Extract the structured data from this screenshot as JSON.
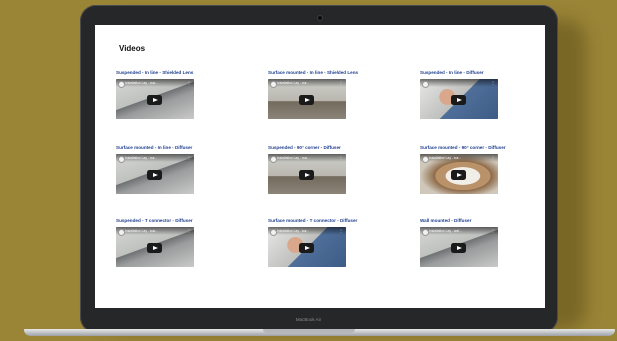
{
  "page": {
    "heading": "Videos"
  },
  "videos": [
    {
      "title": "Suspended - In line - Shielded Lens",
      "thumb_title": "Installation Lay - sus...",
      "scene": "ceiling"
    },
    {
      "title": "Surface mounted - In line - Shielded Lens",
      "thumb_title": "Installation Lay - sur...",
      "scene": "room"
    },
    {
      "title": "Suspended - In line - Diffuser",
      "thumb_title": "",
      "scene": "person"
    },
    {
      "title": "Surface mounted - In line - Diffuser",
      "thumb_title": "Installation Lay - sur...",
      "scene": "ceiling"
    },
    {
      "title": "Suspended - 90° corner - Diffuser",
      "thumb_title": "Installation Lay - sus...",
      "scene": "room"
    },
    {
      "title": "Surface mounted - 90° corner - Diffuser",
      "thumb_title": "Installation Lay - sur...",
      "scene": "wood"
    },
    {
      "title": "Suspended - T connector - Diffuser",
      "thumb_title": "Installation Lay - sus...",
      "scene": "ceiling"
    },
    {
      "title": "Surface mounted - T connector - Diffuser",
      "thumb_title": "Installation Lay - sur...",
      "scene": "person"
    },
    {
      "title": "Wall mounted - Diffuser",
      "thumb_title": "Installation Lay - wal...",
      "scene": "ceiling"
    }
  ],
  "device": {
    "brand_label": "MacBook Air"
  },
  "icons": {
    "play": "play-icon",
    "kebab": "more-icon",
    "channel_logo": "channel-logo-icon"
  },
  "colors": {
    "background": "#9a8436",
    "title_link": "#1f3f8f",
    "bezel": "#262729"
  }
}
